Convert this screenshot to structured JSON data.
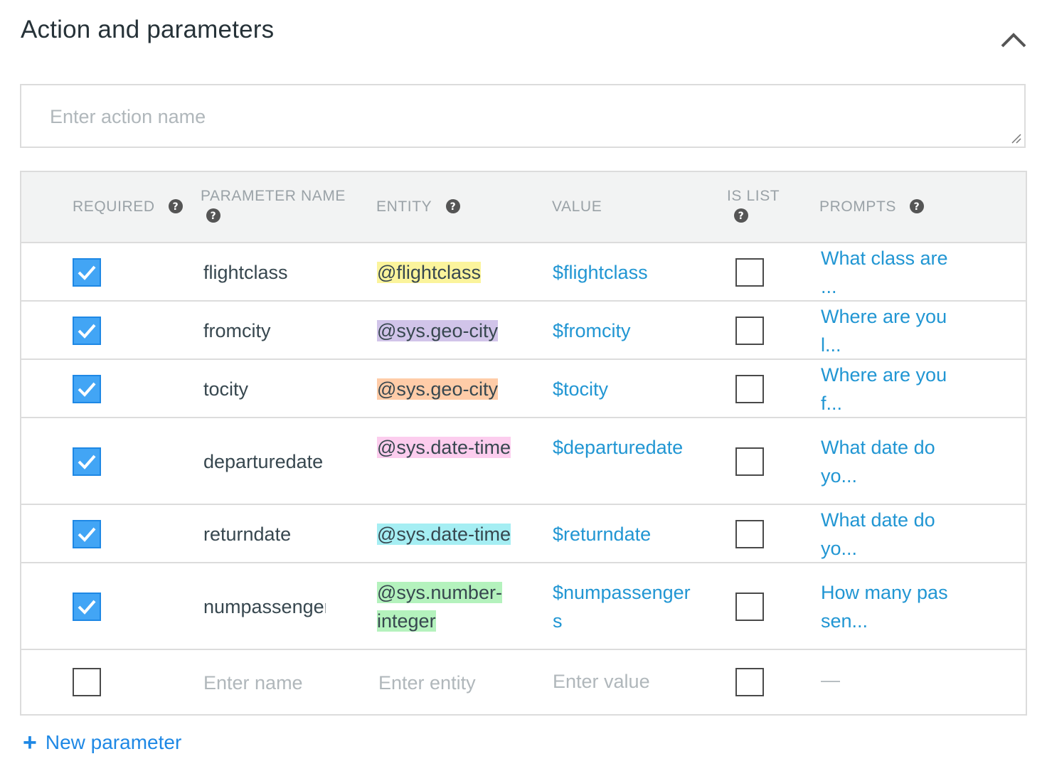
{
  "section": {
    "title": "Action and parameters"
  },
  "action": {
    "placeholder": "Enter action name",
    "value": ""
  },
  "table": {
    "headers": {
      "required": "REQUIRED",
      "parameter_name": "PARAMETER NAME",
      "entity": "ENTITY",
      "value": "VALUE",
      "is_list": "IS LIST",
      "prompts": "PROMPTS"
    },
    "rows": [
      {
        "required": true,
        "name": "flightclass",
        "entity": "@flightclass",
        "entity_color": "#fbf49c",
        "value": "$flightclass",
        "is_list": false,
        "prompt": "What class are ..."
      },
      {
        "required": true,
        "name": "fromcity",
        "entity": "@sys.geo-city",
        "entity_color": "#d1c4e9",
        "value": "$fromcity",
        "is_list": false,
        "prompt": "Where are you l..."
      },
      {
        "required": true,
        "name": "tocity",
        "entity": "@sys.geo-city",
        "entity_color": "#ffcca8",
        "value": "$tocity",
        "is_list": false,
        "prompt": "Where are you f..."
      },
      {
        "required": true,
        "name": "departuredate",
        "entity": "@sys.date-time",
        "entity_color": "#fccdee",
        "value": "$departuredate",
        "is_list": false,
        "prompt": "What date do yo..."
      },
      {
        "required": true,
        "name": "returndate",
        "entity": "@sys.date-time",
        "entity_color": "#a5eef3",
        "value": "$returndate",
        "is_list": false,
        "prompt": "What date do yo..."
      },
      {
        "required": true,
        "name": "numpassengers",
        "entity": "@sys.number-integer",
        "entity_color": "#b4f2bd",
        "value": "$numpassengers",
        "is_list": false,
        "prompt": "How many passen..."
      }
    ],
    "new_row": {
      "required": false,
      "name_placeholder": "Enter name",
      "entity_placeholder": "Enter entity",
      "value_placeholder": "Enter value",
      "is_list": false,
      "prompt": "—"
    }
  },
  "new_parameter": {
    "icon": "+",
    "label": "New parameter"
  },
  "colors": {
    "accent": "#2196d3",
    "checkbox_fill": "#42a5f5",
    "header_bg": "#f2f3f3",
    "border": "#dcdcdc"
  }
}
